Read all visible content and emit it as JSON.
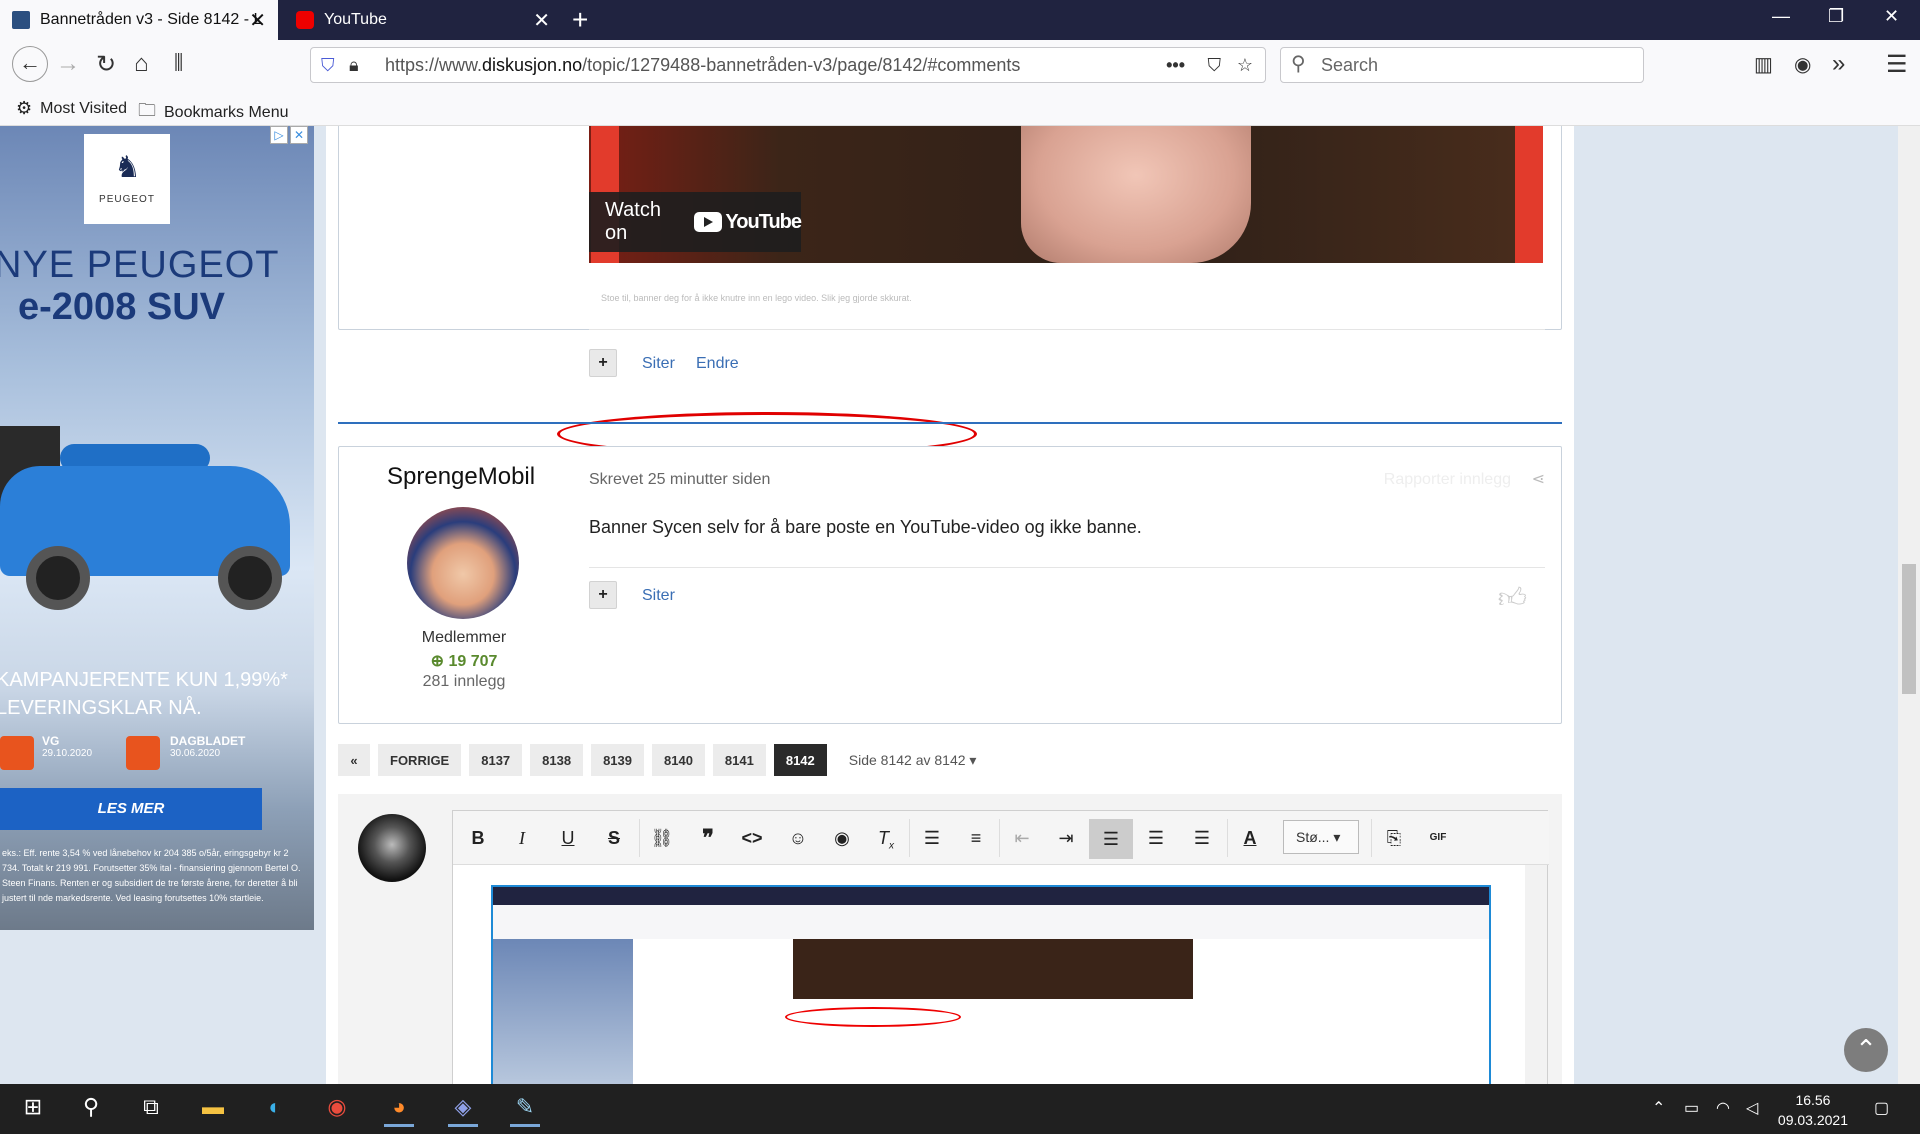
{
  "browser": {
    "tabs": [
      {
        "title": "Bannetråden v3 - Side 8142 - L",
        "active": true
      },
      {
        "title": "YouTube",
        "active": false
      }
    ],
    "url_prefix": "https://www.",
    "url_host": "diskusjon.no",
    "url_path": "/topic/1279488-bannetråden-v3/page/8142/#comments",
    "search_placeholder": "Search",
    "bookmarks": [
      "Most Visited",
      "Bookmarks Menu"
    ]
  },
  "ad": {
    "brand": "PEUGEOT",
    "headline1": "NYE PEUGEOT",
    "headline2": "e-2008 SUV",
    "offer1": "KAMPANJERENTE KUN 1,99%*",
    "offer2": "LEVERINGSKLAR NÅ.",
    "sources": [
      {
        "name": "VG",
        "date": "29.10.2020"
      },
      {
        "name": "DAGBLADET",
        "date": "30.06.2020"
      }
    ],
    "cta": "LES MER",
    "fine": "eks.: Eff. rente 3,54 % ved lånebehov kr 204 385 o/5år, eringsgebyr kr 2 734. Totalt kr 219 991. Forutsetter 35% ital - finansiering gjennom Bertel O. Steen Finans. Renten er og subsidiert de tre første årene, for deretter å bli justert til nde markedsrente. Ved leasing forutsettes 10% startleie."
  },
  "post1": {
    "watch_on": "Watch on",
    "youtube": "YouTube",
    "faint_text": "Stoe til, banner deg for å ikke knutre inn en lego video. Slik jeg gjorde skkurat.",
    "quote": "Siter",
    "edit": "Endre"
  },
  "post2": {
    "author": "SprengeMobil",
    "role": "Medlemmer",
    "reputation": "19 707",
    "posts": "281 innlegg",
    "meta": "Skrevet 25 minutter siden",
    "report": "Rapporter innlegg",
    "body": "Banner Sycen selv for å bare poste en YouTube-video og ikke banne.",
    "quote": "Siter"
  },
  "pager": {
    "prev": "FORRIGE",
    "pages": [
      "8137",
      "8138",
      "8139",
      "8140",
      "8141",
      "8142"
    ],
    "current": "8142",
    "info": "Side 8142 av 8142"
  },
  "editor": {
    "size_label": "Stø..."
  },
  "taskbar": {
    "time": "16.56",
    "date": "09.03.2021"
  }
}
